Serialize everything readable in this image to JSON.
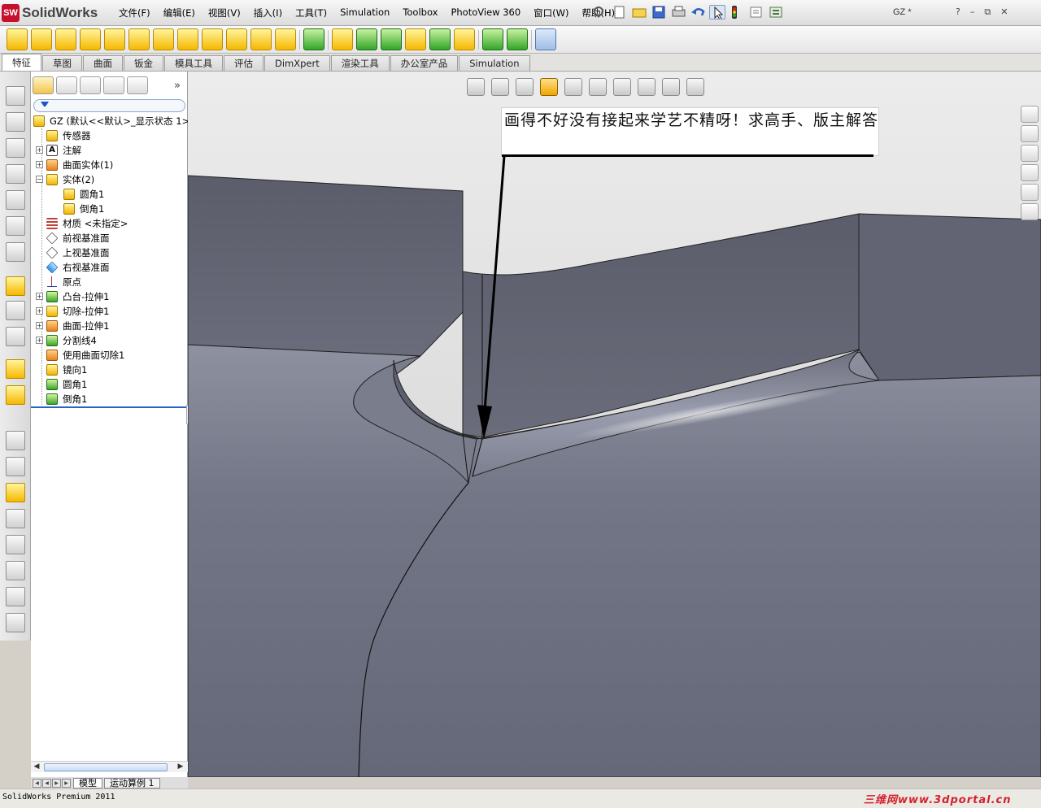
{
  "app": {
    "logo_badge": "SW",
    "name": "SolidWorks",
    "document_title": "GZ *"
  },
  "menu": {
    "items": [
      "文件(F)",
      "编辑(E)",
      "视图(V)",
      "插入(I)",
      "工具(T)",
      "Simulation",
      "Toolbox",
      "PhotoView 360",
      "窗口(W)",
      "帮助(H)"
    ]
  },
  "window_controls": {
    "help": "?",
    "minimize": "–",
    "restore": "⧉",
    "close": "✕"
  },
  "command_tabs": [
    {
      "label": "特征",
      "active": true
    },
    {
      "label": "草图",
      "active": false
    },
    {
      "label": "曲面",
      "active": false
    },
    {
      "label": "钣金",
      "active": false
    },
    {
      "label": "模具工具",
      "active": false
    },
    {
      "label": "评估",
      "active": false
    },
    {
      "label": "DimXpert",
      "active": false
    },
    {
      "label": "渲染工具",
      "active": false
    },
    {
      "label": "办公室产品",
      "active": false
    },
    {
      "label": "Simulation",
      "active": false
    }
  ],
  "feature_tree": {
    "more_tabs": "»",
    "root": "GZ  (默认<<默认>_显示状态 1>)",
    "items": [
      {
        "label": "传感器",
        "expander": "",
        "icon": "sensor-icon"
      },
      {
        "label": "注解",
        "expander": "+",
        "icon": "annotation-icon"
      },
      {
        "label": "曲面实体(1)",
        "expander": "+",
        "icon": "surface-bodies-icon"
      },
      {
        "label": "实体(2)",
        "expander": "−",
        "icon": "solid-bodies-icon"
      },
      {
        "label": "圆角1",
        "expander": "",
        "icon": "body-icon",
        "child": true
      },
      {
        "label": "倒角1",
        "expander": "",
        "icon": "body-icon",
        "child": true
      },
      {
        "label": "材质 <未指定>",
        "expander": "",
        "icon": "material-icon"
      },
      {
        "label": "前视基准面",
        "expander": "",
        "icon": "plane-icon"
      },
      {
        "label": "上视基准面",
        "expander": "",
        "icon": "plane-icon"
      },
      {
        "label": "右视基准面",
        "expander": "",
        "icon": "plane-icon"
      },
      {
        "label": "原点",
        "expander": "",
        "icon": "origin-icon"
      },
      {
        "label": "凸台-拉伸1",
        "expander": "+",
        "icon": "boss-extrude-icon"
      },
      {
        "label": "切除-拉伸1",
        "expander": "+",
        "icon": "cut-extrude-icon"
      },
      {
        "label": "曲面-拉伸1",
        "expander": "+",
        "icon": "surface-extrude-icon"
      },
      {
        "label": "分割线4",
        "expander": "+",
        "icon": "split-line-icon"
      },
      {
        "label": "使用曲面切除1",
        "expander": "",
        "icon": "surface-cut-icon"
      },
      {
        "label": "镜向1",
        "expander": "",
        "icon": "mirror-icon"
      },
      {
        "label": "圆角1",
        "expander": "",
        "icon": "fillet-icon"
      },
      {
        "label": "倒角1",
        "expander": "",
        "icon": "chamfer-icon"
      }
    ]
  },
  "bottom_tabs": [
    {
      "label": "模型",
      "active": true
    },
    {
      "label": "运动算例 1",
      "active": false
    }
  ],
  "annotation": {
    "text": "画得不好没有接起来学艺不精呀！求高手、版主解答"
  },
  "status": {
    "text": "SolidWorks Premium 2011",
    "watermark": "三维网www.3dportal.cn"
  },
  "colors": {
    "model_face": "#6d6f7e",
    "model_face_light": "#8a8d9c",
    "background_top": "#d6d6d6",
    "accent_selection": "#f1a500",
    "watermark": "#d6202a"
  }
}
